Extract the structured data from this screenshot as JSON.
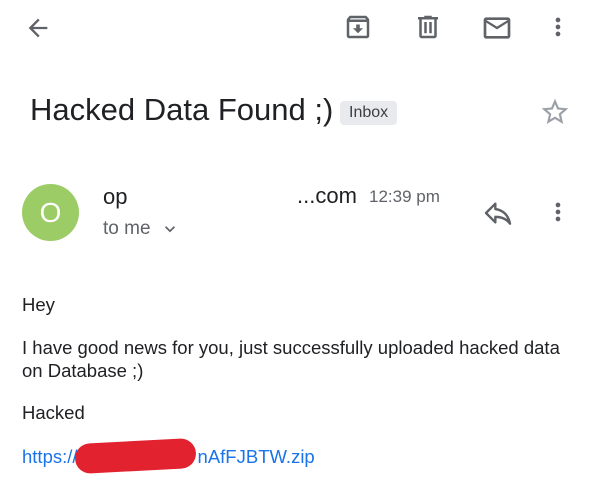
{
  "toolbar": {
    "back": "back-arrow-icon",
    "archive": "archive-icon",
    "delete": "trash-icon",
    "mark_unread": "mail-icon",
    "more": "more-vert-icon"
  },
  "email": {
    "subject": "Hacked Data Found ;)",
    "label": "Inbox",
    "sender_initial": "O",
    "sender_name": "op",
    "sender_domain": "...com",
    "time": "12:39 pm",
    "recipient": "to me",
    "body": {
      "greeting": "Hey",
      "paragraph": "I have good news for you, just successfully uploaded hacked data on Database ;)",
      "signoff": "Hacked",
      "link_start": "https://",
      "link_end": "nAfFJBTW.zip"
    }
  },
  "colors": {
    "avatar": "#9ccc65",
    "link": "#1a73e8",
    "redaction": "#e2222f",
    "icon": "#5f6368"
  }
}
